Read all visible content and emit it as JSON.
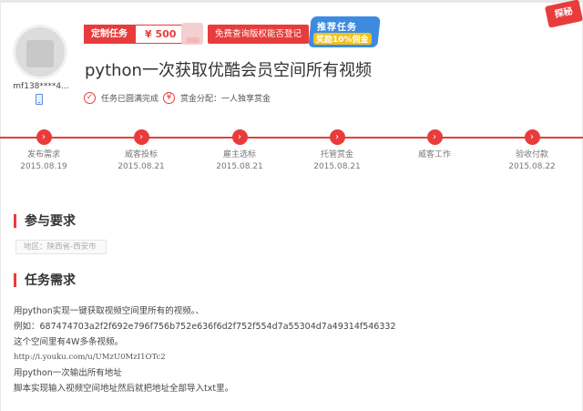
{
  "user": {
    "name": "mf138****4..."
  },
  "task": {
    "tag_label": "定制任务",
    "price": "¥ 500",
    "check_button": "免费查询版权能否登记",
    "promo_line1": "推荐任务",
    "promo_line2": "奖励10%佣金",
    "corner_badge": "探秘",
    "title": "python一次获取优酷会员空间所有视频",
    "status_done_icon": "check-circle-icon",
    "status_done": "任务已圆满完成",
    "status_reward_icon": "yen-circle-icon",
    "status_reward": "赏金分配：一人独享赏金"
  },
  "timeline": {
    "accent": "#e83c3c",
    "steps": [
      {
        "name": "发布需求",
        "date": "2015.08.19"
      },
      {
        "name": "威客投标",
        "date": "2015.08.21"
      },
      {
        "name": "雇主选标",
        "date": "2015.08.21"
      },
      {
        "name": "托管赏金",
        "date": "2015.08.21"
      },
      {
        "name": "威客工作",
        "date": ""
      },
      {
        "name": "验收付款",
        "date": "2015.08.22"
      }
    ]
  },
  "participation": {
    "heading": "参与要求",
    "location": "地区：陕西省-西安市"
  },
  "requirement": {
    "heading": "任务需求",
    "lines": [
      "用python实现一键获取视频空间里所有的视频。、",
      "例如：687474703a2f2f692e796f756b752e636f6d2f752f554d7a55304d7a49314f546332",
      "这个空间里有4W多条视频。",
      "http://i.youku.com/u/UMzU0MzI1OTc2",
      "用python一次输出所有地址",
      "脚本实现输入视频空间地址然后就把地址全部导入txt里。"
    ]
  }
}
